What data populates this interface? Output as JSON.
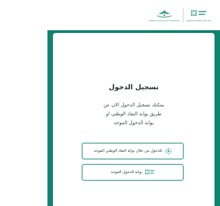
{
  "header": {
    "left_logo_caption": "Digital Government Authority",
    "right_logo_caption": "National Single Sign-On"
  },
  "login": {
    "title": "تسجيل الدخول",
    "description_lines": [
      "يمكنك تسجيل الدخول الان عن",
      "طريق بوابة النفاذ الوطني او",
      "بوابة الدخول الموحد"
    ],
    "nafath_button_label": "للدخول من خلال بوابة النفاذ الوطني الموحد",
    "sso_button_label": "بوابة الدخول الموحد"
  },
  "colors": {
    "brand_green": "#10846f",
    "button_border": "#2e9a82"
  },
  "icons": {
    "nafath": "nafath-dots-icon",
    "sso": "sso-grid-icon"
  }
}
